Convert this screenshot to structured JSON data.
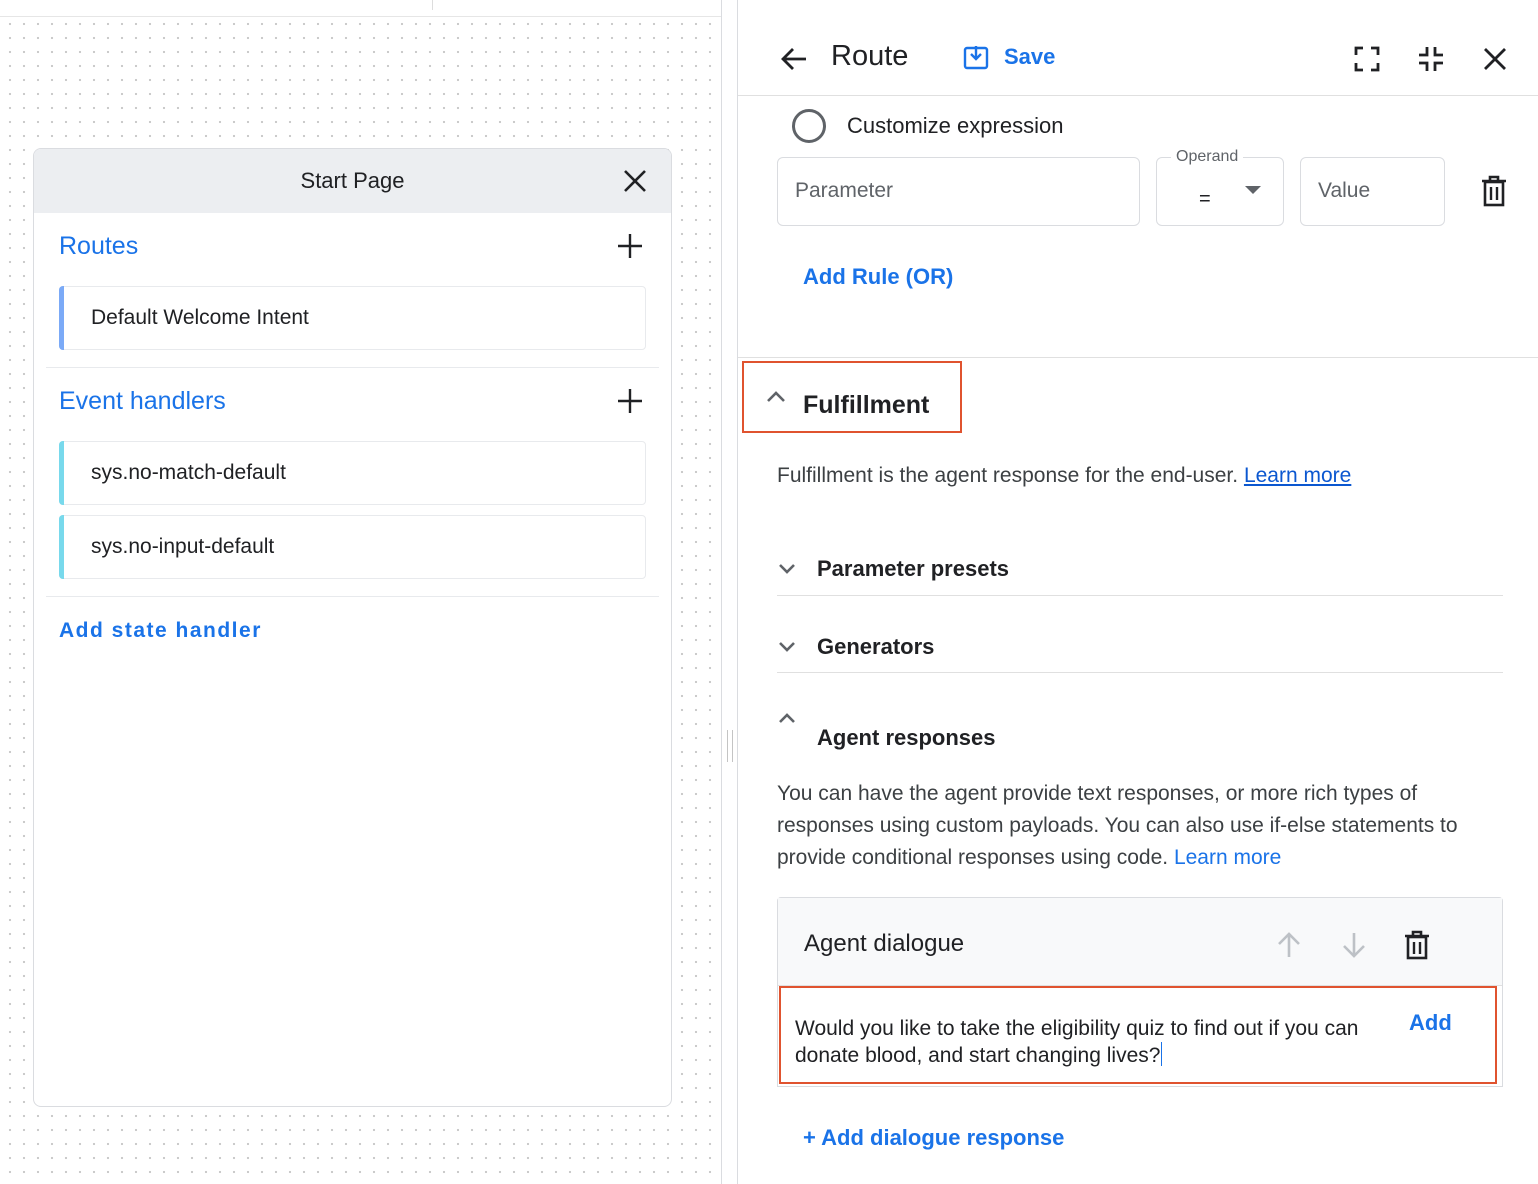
{
  "canvas": {
    "start_page": {
      "title": "Start Page",
      "routes_title": "Routes",
      "routes": [
        "Default Welcome Intent"
      ],
      "event_handlers_title": "Event handlers",
      "event_handlers": [
        "sys.no-match-default",
        "sys.no-input-default"
      ],
      "add_state_handler": "Add state handler"
    }
  },
  "panel": {
    "header": {
      "title": "Route",
      "save_label": "Save"
    },
    "condition": {
      "radio_label": "Customize expression",
      "parameter_placeholder": "Parameter",
      "operand_label": "Operand",
      "operand_value": "=",
      "value_placeholder": "Value",
      "add_rule": "Add Rule (OR)"
    },
    "fulfillment": {
      "title": "Fulfillment",
      "description": "Fulfillment is the agent response for the end-user.",
      "learn_more": "Learn more",
      "sections": {
        "parameter_presets": "Parameter presets",
        "generators": "Generators",
        "agent_responses": "Agent responses"
      },
      "agent_responses_desc": "You can have the agent provide text responses, or more rich types of responses using custom payloads. You can also use if-else statements to provide conditional responses using code.",
      "agent_responses_learn_more": "Learn more",
      "agent_dialogue": {
        "title": "Agent dialogue",
        "text": "Would you like to take the eligibility quiz to find out if you can donate blood, and start changing lives?",
        "add_label": "Add"
      },
      "add_dialogue_response": "+ Add dialogue response"
    }
  },
  "colors": {
    "accent": "#1a73e8",
    "highlight_border": "#e0532f",
    "route_bar": "#7baaf7",
    "event_bar": "#78d9ec"
  }
}
